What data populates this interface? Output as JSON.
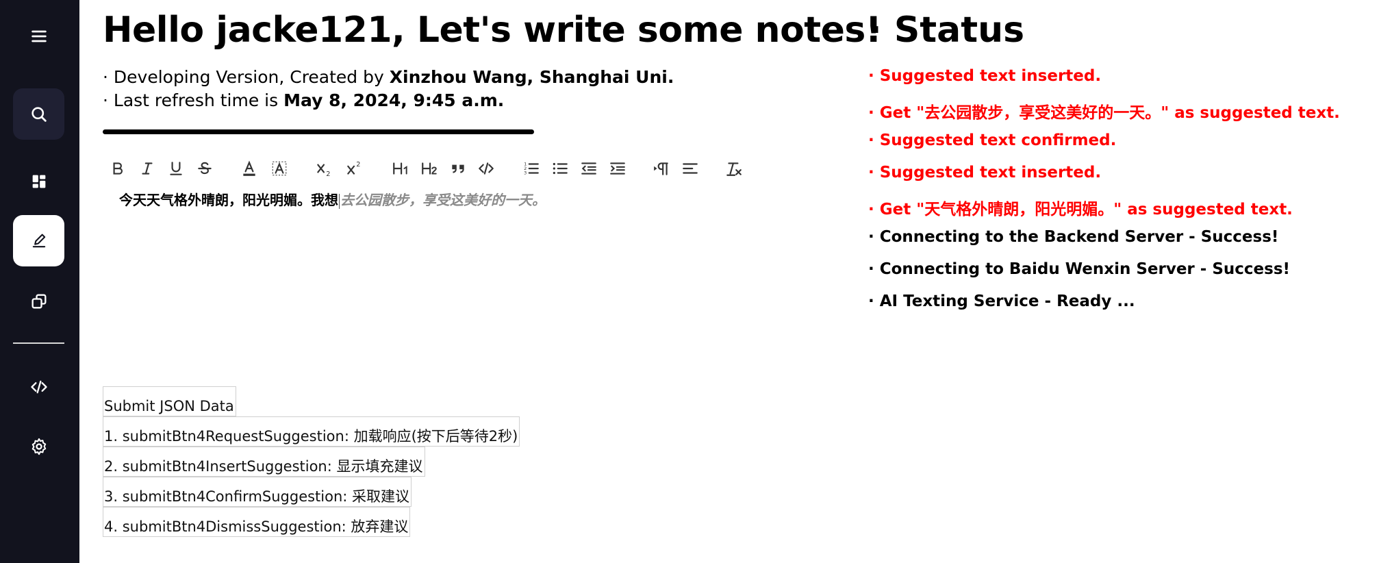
{
  "sidebar": {
    "items": [
      {
        "name": "menu",
        "icon": "menu-icon"
      },
      {
        "name": "search",
        "icon": "search-icon"
      },
      {
        "name": "dashboard",
        "icon": "dashboard-icon"
      },
      {
        "name": "edit",
        "icon": "pencil-icon",
        "active": true
      },
      {
        "name": "copy",
        "icon": "copy-icon"
      },
      {
        "name": "code",
        "icon": "code-icon"
      },
      {
        "name": "settings",
        "icon": "gear-icon"
      }
    ],
    "bg_color": "#12131e"
  },
  "main": {
    "greeting": "Hello jacke121, Let's write some notes!",
    "info1_prefix": "· Developing Version, Created by ",
    "info1_bold": "Xinzhou Wang, Shanghai Uni.",
    "info2_prefix": "· Last refresh time is ",
    "info2_bold": "May 8, 2024, 9:45 a.m."
  },
  "toolbar": {
    "items": [
      {
        "name": "bold",
        "icon": "bold-icon"
      },
      {
        "name": "italic",
        "icon": "italic-icon"
      },
      {
        "name": "underline",
        "icon": "underline-icon"
      },
      {
        "name": "strike",
        "icon": "strikethrough-icon"
      },
      {
        "name": "font-color",
        "icon": "font-color-icon"
      },
      {
        "name": "highlight",
        "icon": "highlight-icon"
      },
      {
        "name": "subscript",
        "icon": "subscript-icon"
      },
      {
        "name": "superscript",
        "icon": "superscript-icon"
      },
      {
        "name": "heading-1",
        "icon": "heading-1-icon"
      },
      {
        "name": "heading-2",
        "icon": "heading-2-icon"
      },
      {
        "name": "blockquote",
        "icon": "quote-icon"
      },
      {
        "name": "code",
        "icon": "code-icon"
      },
      {
        "name": "ordered-list",
        "icon": "ordered-list-icon"
      },
      {
        "name": "bullet-list",
        "icon": "bullet-list-icon"
      },
      {
        "name": "outdent",
        "icon": "outdent-icon"
      },
      {
        "name": "indent",
        "icon": "indent-icon"
      },
      {
        "name": "text-direction",
        "icon": "pilcrow-icon"
      },
      {
        "name": "align",
        "icon": "align-left-icon"
      },
      {
        "name": "clear-format",
        "icon": "clear-format-icon"
      }
    ]
  },
  "editor": {
    "text": "今天天气格外晴朗，阳光明媚。我想",
    "suggestion": "去公园散步，享受这美好的一天。"
  },
  "json_buttons": {
    "submit": "Submit JSON Data",
    "b1": "1. submitBtn4RequestSuggestion: 加载响应(按下后等待2秒)",
    "b2": "2. submitBtn4InsertSuggestion: 显示填充建议",
    "b3": "3. submitBtn4ConfirmSuggestion: 采取建议",
    "b4": "4. submitBtn4DismissSuggestion: 放弃建议"
  },
  "status": {
    "title": "· Status",
    "lines": [
      {
        "text": "· Suggested text inserted.",
        "color": "#ff0000"
      },
      {
        "text": "· Get \"去公园散步，享受这美好的一天。\" as suggested text.",
        "color": "#ff0000"
      },
      {
        "text": "· Suggested text confirmed.",
        "color": "#ff0000"
      },
      {
        "text": "· Suggested text inserted.",
        "color": "#ff0000"
      },
      {
        "text": "· Get \"天气格外晴朗，阳光明媚。\" as suggested text.",
        "color": "#ff0000"
      },
      {
        "text": "· Connecting to the Backend Server - Success!",
        "color": "#000000"
      },
      {
        "text": "· Connecting to Baidu Wenxin Server - Success!",
        "color": "#000000"
      },
      {
        "text": "· AI Texting Service - Ready ...",
        "color": "#000000"
      }
    ]
  }
}
